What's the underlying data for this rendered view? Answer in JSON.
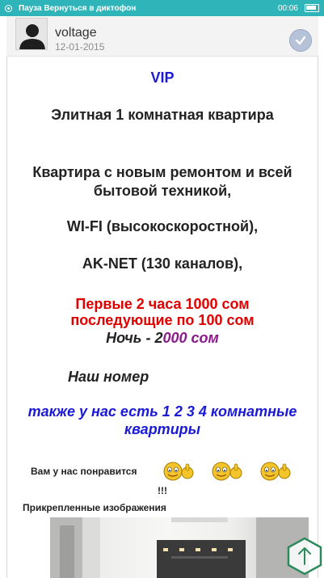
{
  "status_bar": {
    "text": "Пауза Вернуться в диктофон",
    "time": "00:06",
    "color": "#2fb5b9"
  },
  "post": {
    "username": "voltage",
    "date": "12-01-2015"
  },
  "content": {
    "vip": "VIP",
    "title": "Элитная 1 комнатная квартира",
    "description": "Квартира с новым ремонтом и всей бытовой техникой,",
    "wifi": "WI-FI (высокоскоростной),",
    "aknet": "AK-NET (130 каналов),",
    "price_line1": "Первые 2 часа 1000 сом",
    "price_line2": "последующие по 100 сом",
    "night_prefix": "Ночь - 2",
    "night_value": "000 сом",
    "phone_label": "Наш номер",
    "also_text": "также у нас есть 1  2  3  4 комнатные квартиры",
    "like_text": "Вам у нас понравится",
    "like_excl": "!!!",
    "attachments_label": "Прикрепленные изображения"
  },
  "icons": {
    "status": "record-icon",
    "battery": "battery-icon",
    "check": "check-circle-icon",
    "scroll": "scroll-up-icon",
    "smiley": "thumbs-up-smiley-icon"
  },
  "colors": {
    "vip": "#1a1ad6",
    "price": "#e00000",
    "night_value": "#8a1a8a",
    "also": "#1a1ad6"
  }
}
